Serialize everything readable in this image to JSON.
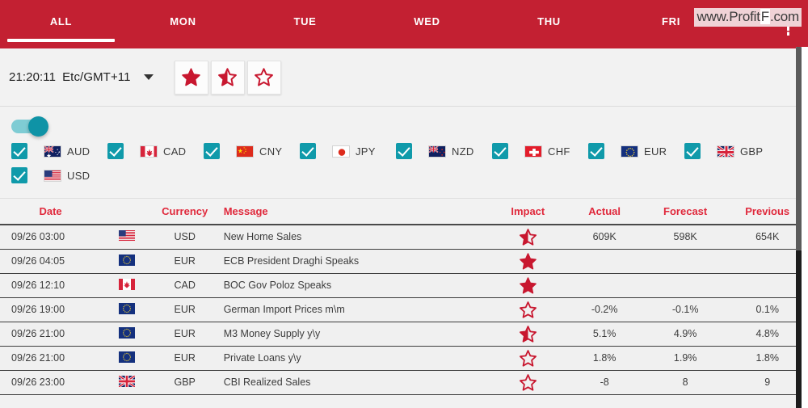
{
  "tabs": [
    {
      "label": "ALL",
      "active": true
    },
    {
      "label": "MON",
      "active": false
    },
    {
      "label": "TUE",
      "active": false
    },
    {
      "label": "WED",
      "active": false
    },
    {
      "label": "THU",
      "active": false
    },
    {
      "label": "FRI",
      "active": false
    }
  ],
  "watermark": {
    "prefix": "www.Profit",
    "highlight": "F",
    "suffix": ".com"
  },
  "toolbar": {
    "time": "21:20:11",
    "timezone": "Etc/GMT+11",
    "caret_icon": "chevron-down-icon",
    "impact_filters": [
      {
        "name": "star-filled-icon",
        "state": "full",
        "label": "High impact"
      },
      {
        "name": "star-half-icon",
        "state": "half",
        "label": "Medium impact"
      },
      {
        "name": "star-outline-icon",
        "state": "empty",
        "label": "Low impact"
      }
    ]
  },
  "filters": {
    "toggle_on": true,
    "currencies": [
      {
        "code": "AUD",
        "flag": "au",
        "checked": true
      },
      {
        "code": "CAD",
        "flag": "ca",
        "checked": true
      },
      {
        "code": "CNY",
        "flag": "cn",
        "checked": true
      },
      {
        "code": "JPY",
        "flag": "jp",
        "checked": true
      },
      {
        "code": "NZD",
        "flag": "nz",
        "checked": true
      },
      {
        "code": "CHF",
        "flag": "ch",
        "checked": true
      },
      {
        "code": "EUR",
        "flag": "eu",
        "checked": true
      },
      {
        "code": "GBP",
        "flag": "gb",
        "checked": true
      },
      {
        "code": "USD",
        "flag": "us",
        "checked": true
      }
    ]
  },
  "table": {
    "headers": {
      "date": "Date",
      "currency": "Currency",
      "message": "Message",
      "impact": "Impact",
      "actual": "Actual",
      "forecast": "Forecast",
      "previous": "Previous"
    },
    "rows": [
      {
        "date": "09/26 03:00",
        "flag": "us",
        "currency": "USD",
        "message": "New Home Sales",
        "impact": "half",
        "actual": "609K",
        "forecast": "598K",
        "previous": "654K"
      },
      {
        "date": "09/26 04:05",
        "flag": "eu",
        "currency": "EUR",
        "message": "ECB President Draghi Speaks",
        "impact": "full",
        "actual": "",
        "forecast": "",
        "previous": ""
      },
      {
        "date": "09/26 12:10",
        "flag": "ca",
        "currency": "CAD",
        "message": "BOC Gov Poloz Speaks",
        "impact": "full",
        "actual": "",
        "forecast": "",
        "previous": ""
      },
      {
        "date": "09/26 19:00",
        "flag": "eu",
        "currency": "EUR",
        "message": "German Import Prices m\\m",
        "impact": "empty",
        "actual": "-0.2%",
        "forecast": "-0.1%",
        "previous": "0.1%"
      },
      {
        "date": "09/26 21:00",
        "flag": "eu",
        "currency": "EUR",
        "message": "M3 Money Supply y\\y",
        "impact": "half",
        "actual": "5.1%",
        "forecast": "4.9%",
        "previous": "4.8%"
      },
      {
        "date": "09/26 21:00",
        "flag": "eu",
        "currency": "EUR",
        "message": "Private Loans y\\y",
        "impact": "empty",
        "actual": "1.8%",
        "forecast": "1.9%",
        "previous": "1.8%"
      },
      {
        "date": "09/26 23:00",
        "flag": "gb",
        "currency": "GBP",
        "message": "CBI Realized Sales",
        "impact": "empty",
        "actual": "-8",
        "forecast": "8",
        "previous": "9"
      }
    ]
  },
  "colors": {
    "brand_red": "#c32032",
    "header_text_red": "#e0293c",
    "accent_teal": "#109aaa",
    "toggle_track": "#7fccd4",
    "star_red": "#c8172f",
    "panel_bg": "#f2f2f2"
  }
}
